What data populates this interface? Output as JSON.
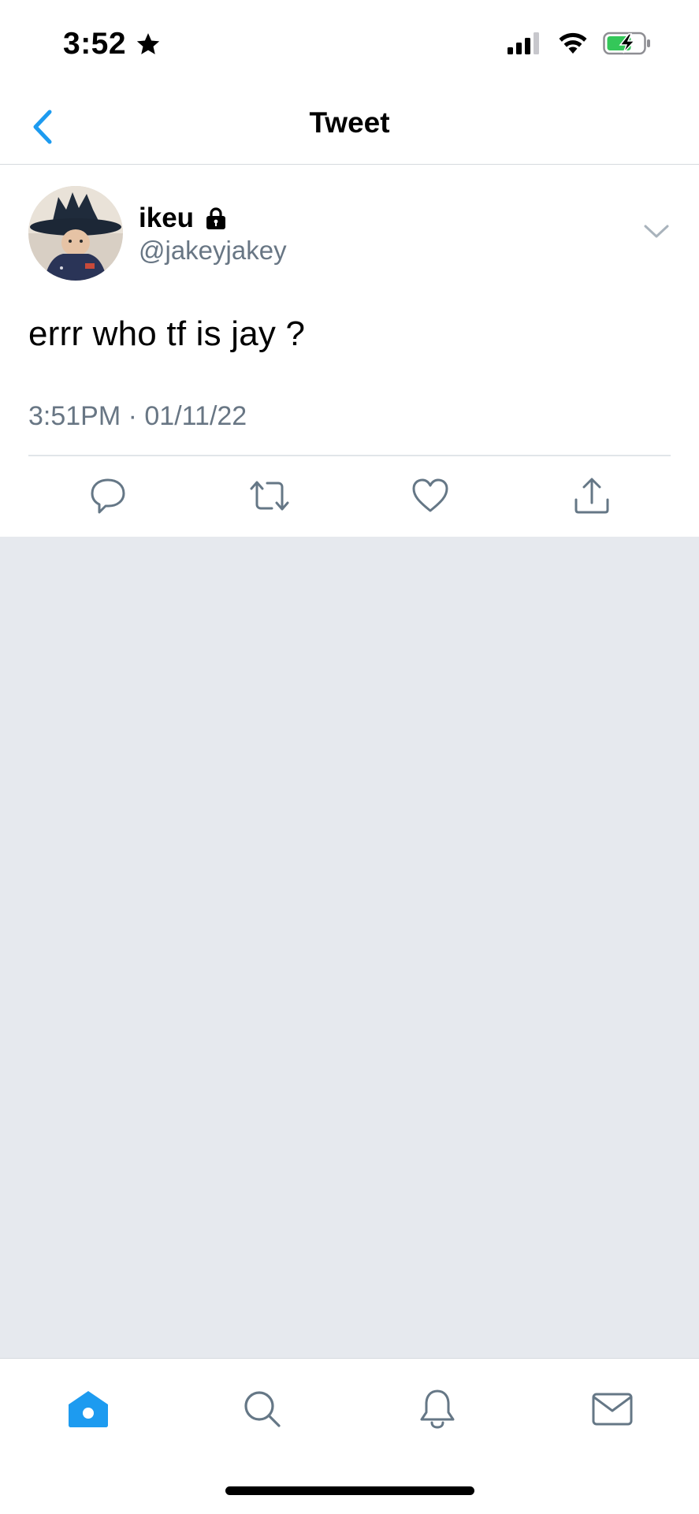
{
  "status_bar": {
    "time": "3:52",
    "location_icon": "star-icon",
    "signal_icon": "cellular-signal-icon",
    "wifi_icon": "wifi-icon",
    "battery_icon": "battery-charging-icon",
    "battery_color": "#34c759"
  },
  "nav": {
    "title": "Tweet",
    "back_icon": "chevron-left-icon",
    "accent_color": "#1d9bf0"
  },
  "tweet": {
    "author_name": "ikeu",
    "author_handle": "@jakeyjakey",
    "protected_icon": "lock-icon",
    "text": "errr who tf is jay ?",
    "timestamp": "3:51PM · 01/11/22",
    "menu_icon": "chevron-down-icon",
    "actions": [
      {
        "name": "reply",
        "icon": "reply-icon"
      },
      {
        "name": "retweet",
        "icon": "retweet-icon"
      },
      {
        "name": "like",
        "icon": "heart-icon"
      },
      {
        "name": "share",
        "icon": "share-icon"
      }
    ]
  },
  "tab_bar": {
    "tabs": [
      {
        "name": "home",
        "icon": "home-icon",
        "active": true
      },
      {
        "name": "search",
        "icon": "search-icon",
        "active": false
      },
      {
        "name": "notifications",
        "icon": "bell-icon",
        "active": false
      },
      {
        "name": "messages",
        "icon": "mail-icon",
        "active": false
      }
    ]
  }
}
